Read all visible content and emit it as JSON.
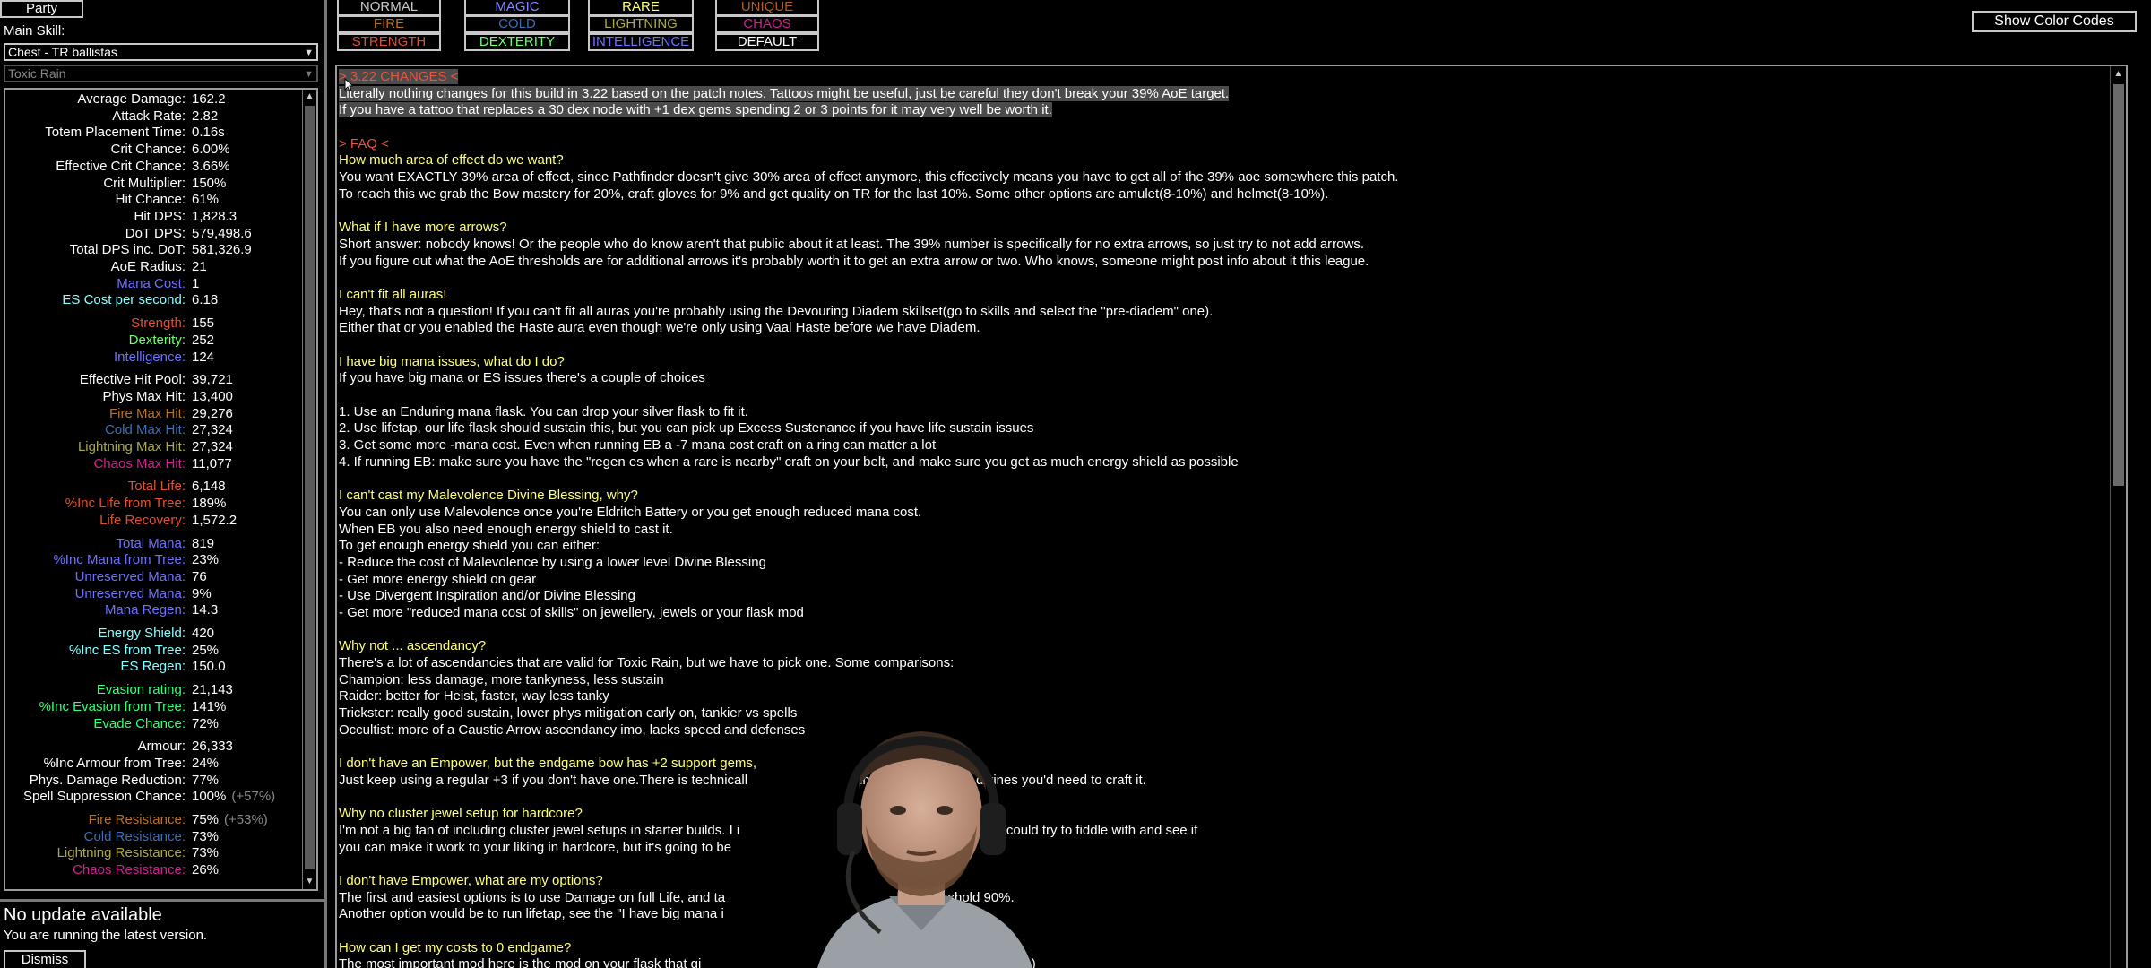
{
  "sidebar": {
    "party_label": "Party",
    "main_skill_label": "Main Skill:",
    "skill_select": "Chest - TR ballistas",
    "gem_select": "Toxic Rain",
    "stats": [
      {
        "label": "Average Damage:",
        "value": "162.2",
        "color": "#ffffff"
      },
      {
        "label": "Attack Rate:",
        "value": "2.82",
        "color": "#ffffff"
      },
      {
        "label": "Totem Placement Time:",
        "value": "0.16s",
        "color": "#ffffff"
      },
      {
        "label": "Crit Chance:",
        "value": "6.00%",
        "color": "#ffffff"
      },
      {
        "label": "Effective Crit Chance:",
        "value": "3.66%",
        "color": "#ffffff"
      },
      {
        "label": "Crit Multiplier:",
        "value": "150%",
        "color": "#ffffff"
      },
      {
        "label": "Hit Chance:",
        "value": "61%",
        "color": "#ffffff"
      },
      {
        "label": "Hit DPS:",
        "value": "1,828.3",
        "color": "#ffffff"
      },
      {
        "label": "DoT DPS:",
        "value": "579,498.6",
        "color": "#ffffff"
      },
      {
        "label": "Total DPS inc. DoT:",
        "value": "581,326.9",
        "color": "#ffffff"
      },
      {
        "label": "AoE Radius:",
        "value": "21",
        "color": "#ffffff"
      },
      {
        "label": "Mana Cost:",
        "value": "1",
        "color": "#7070ff"
      },
      {
        "label": "ES Cost per second:",
        "value": "6.18",
        "color": "#88ffff"
      },
      {
        "label": "Strength:",
        "value": "155",
        "color": "#e05030",
        "gap": true
      },
      {
        "label": "Dexterity:",
        "value": "252",
        "color": "#70ff70"
      },
      {
        "label": "Intelligence:",
        "value": "124",
        "color": "#7070ff"
      },
      {
        "label": "Effective Hit Pool:",
        "value": "39,721",
        "color": "#ffffff",
        "gap": true
      },
      {
        "label": "Phys Max Hit:",
        "value": "13,400",
        "color": "#ffffff"
      },
      {
        "label": "Fire Max Hit:",
        "value": "29,276",
        "color": "#b97123"
      },
      {
        "label": "Cold Max Hit:",
        "value": "27,324",
        "color": "#3f6db3"
      },
      {
        "label": "Lightning Max Hit:",
        "value": "27,324",
        "color": "#adaa47"
      },
      {
        "label": "Chaos Max Hit:",
        "value": "11,077",
        "color": "#d02090"
      },
      {
        "label": "Total Life:",
        "value": "6,148",
        "color": "#e05030",
        "gap": true
      },
      {
        "label": "%Inc Life from Tree:",
        "value": "189%",
        "color": "#e05030"
      },
      {
        "label": "Life Recovery:",
        "value": "1,572.2",
        "color": "#e05030"
      },
      {
        "label": "Total Mana:",
        "value": "819",
        "color": "#7070ff",
        "gap": true
      },
      {
        "label": "%Inc Mana from Tree:",
        "value": "23%",
        "color": "#7070ff"
      },
      {
        "label": "Unreserved Mana:",
        "value": "76",
        "color": "#7070ff"
      },
      {
        "label": "Unreserved Mana:",
        "value": "9%",
        "color": "#7070ff"
      },
      {
        "label": "Mana Regen:",
        "value": "14.3",
        "color": "#7070ff"
      },
      {
        "label": "Energy Shield:",
        "value": "420",
        "color": "#88ffff",
        "gap": true
      },
      {
        "label": "%Inc ES from Tree:",
        "value": "25%",
        "color": "#88ffff"
      },
      {
        "label": "ES Regen:",
        "value": "150.0",
        "color": "#88ffff"
      },
      {
        "label": "Evasion rating:",
        "value": "21,143",
        "color": "#33ff77",
        "gap": true
      },
      {
        "label": "%Inc Evasion from Tree:",
        "value": "141%",
        "color": "#33ff77"
      },
      {
        "label": "Evade Chance:",
        "value": "72%",
        "color": "#33ff77"
      },
      {
        "label": "Armour:",
        "value": "26,333",
        "color": "#ffffff",
        "gap": true
      },
      {
        "label": "%Inc Armour from Tree:",
        "value": "24%",
        "color": "#ffffff"
      },
      {
        "label": "Phys. Damage Reduction:",
        "value": "77%",
        "color": "#ffffff"
      },
      {
        "label": "Spell Suppression Chance:",
        "value": "100%",
        "extra": "(+57%)",
        "color": "#ffffff"
      },
      {
        "label": "Fire Resistance:",
        "value": "75%",
        "extra": "(+53%)",
        "color": "#b97123",
        "gap": true
      },
      {
        "label": "Cold Resistance:",
        "value": "73%",
        "color": "#3f6db3"
      },
      {
        "label": "Lightning Resistance:",
        "value": "73%",
        "color": "#adaa47"
      },
      {
        "label": "Chaos Resistance:",
        "value": "26%",
        "color": "#d02090"
      }
    ],
    "update_title": "No update available",
    "update_subtitle": "You are running the latest version.",
    "dismiss_label": "Dismiss"
  },
  "color_buttons": [
    {
      "label": "NORMAL",
      "color": "#c8c8c8"
    },
    {
      "label": "MAGIC",
      "color": "#8888ff"
    },
    {
      "label": "RARE",
      "color": "#ffff77"
    },
    {
      "label": "UNIQUE",
      "color": "#af6025"
    },
    {
      "label": "FIRE",
      "color": "#b97123"
    },
    {
      "label": "COLD",
      "color": "#3f6db3"
    },
    {
      "label": "LIGHTNING",
      "color": "#adaa47"
    },
    {
      "label": "CHAOS",
      "color": "#d02090"
    },
    {
      "label": "STRENGTH",
      "color": "#e05030"
    },
    {
      "label": "DEXTERITY",
      "color": "#70ff70"
    },
    {
      "label": "INTELLIGENCE",
      "color": "#7070ff"
    },
    {
      "label": "DEFAULT",
      "color": "#ffffff"
    }
  ],
  "show_color_codes_label": "Show Color Codes",
  "notes": [
    {
      "text": "> 3.22 CHANGES <",
      "type": "sec",
      "hl": true
    },
    {
      "text": "Literally nothing changes for this build in 3.22 based on the patch notes. Tattoos might be useful, just be careful they don't break your 39% AoE target.",
      "hl": true
    },
    {
      "text": "If you have a tattoo that replaces a 30 dex node with +1 dex gems spending 2 or 3 points for it may very well be worth it.",
      "hl": true
    },
    {
      "text": ""
    },
    {
      "text": "> FAQ <",
      "type": "sec"
    },
    {
      "text": "How much area of effect do we want?",
      "type": "h"
    },
    {
      "text": "You want EXACTLY 39% area of effect, since Pathfinder doesn't give 30% area of effect anymore, this effectively means you have to get all of the 39% aoe somewhere this patch."
    },
    {
      "text": "To reach this we grab the Bow mastery for 20%, craft gloves for 9% and get quality on TR for the last 10%. Some other options are amulet(8-10%) and helmet(8-10%)."
    },
    {
      "text": ""
    },
    {
      "text": "What if I have more arrows?",
      "type": "h"
    },
    {
      "text": "Short answer: nobody knows! Or the people who do know aren't that public about it at least. The 39% number is specifically for no extra arrows, so just try to not add arrows."
    },
    {
      "text": "If you figure out what the AoE thresholds are for additional arrows it's probably worth it to get an extra arrow or two. Who knows, someone might post info about it this league."
    },
    {
      "text": ""
    },
    {
      "text": "I can't fit all auras!",
      "type": "h"
    },
    {
      "text": "Hey, that's not a question! If you can't fit all auras you're probably using the Devouring Diadem skillset(go to skills and select the \"pre-diadem\" one)."
    },
    {
      "text": "Either that or you enabled the Haste aura even though we're only using Vaal Haste before we have Diadem."
    },
    {
      "text": ""
    },
    {
      "text": "I have big mana issues, what do I do?",
      "type": "h"
    },
    {
      "text": "If you have big mana or ES issues there's a couple of choices"
    },
    {
      "text": ""
    },
    {
      "text": "1. Use an Enduring mana flask. You can drop your silver flask to fit it."
    },
    {
      "text": "2. Use lifetap, our life flask should sustain this, but you can pick up Excess Sustenance if you have life sustain issues"
    },
    {
      "text": "3. Get some more -mana cost. Even when running EB a -7 mana cost craft on a ring can matter a lot"
    },
    {
      "text": "4. If running EB: make sure you have the \"regen es when a rare is nearby\" craft on your belt, and make sure you get as much energy shield as possible"
    },
    {
      "text": ""
    },
    {
      "text": "I can't cast my Malevolence Divine Blessing, why?",
      "type": "h"
    },
    {
      "text": "You can only use Malevolence once you're Eldritch Battery or you get enough reduced mana cost."
    },
    {
      "text": "When EB you also need enough energy shield to cast it."
    },
    {
      "text": "To get enough energy shield you can either:"
    },
    {
      "text": "- Reduce the cost of Malevolence by using a lower level Divine Blessing"
    },
    {
      "text": "- Get more energy shield on gear"
    },
    {
      "text": "- Use Divergent Inspiration and/or Divine Blessing"
    },
    {
      "text": "- Get more \"reduced mana cost of skills\" on jewellery, jewels or your flask mod"
    },
    {
      "text": ""
    },
    {
      "text": "Why not ... ascendancy?",
      "type": "h"
    },
    {
      "text": "There's a lot of ascendancies that are valid for Toxic Rain, but we have to pick one. Some comparisons:"
    },
    {
      "text": "Champion: less damage, more tankyness, less sustain"
    },
    {
      "text": "Raider: better for Heist, faster, way less tanky"
    },
    {
      "text": "Trickster: really good sustain, lower phys mitigation early on, tankier vs spells"
    },
    {
      "text": "Occultist: more of a Caustic Arrow ascendancy imo, lacks speed and defenses"
    },
    {
      "text": ""
    },
    {
      "text": "I don't have an Empower, but the endgame bow has +2 support gems,",
      "type": "h"
    },
    {
      "text": "Just keep using a regular +3 if you don't have one.There is technicall                              imply not worth the divines you'd need to craft it."
    },
    {
      "text": ""
    },
    {
      "text": "Why no cluster jewel setup for hardcore?",
      "type": "h"
    },
    {
      "text": "I'm not a big fan of including cluster jewel setups in starter builds. I i                                      for Softcore that you could try to fiddle with and see if"
    },
    {
      "text": "you can make it work to your liking in hardcore, but it's going to be"
    },
    {
      "text": ""
    },
    {
      "text": "I don't have Empower, what are my options?",
      "type": "h"
    },
    {
      "text": "The first and easiest options is to use Damage on full Life, and ta                                              l life threshold 90%."
    },
    {
      "text": "Another option would be to run lifetap, see the \"I have big mana i                                             that."
    },
    {
      "text": ""
    },
    {
      "text": "How can I get my costs to 0 endgame?",
      "type": "h"
    },
    {
      "text": "The most important mod here is the mod on your flask that gi                                                        ewellery and jewel(s)"
    }
  ]
}
